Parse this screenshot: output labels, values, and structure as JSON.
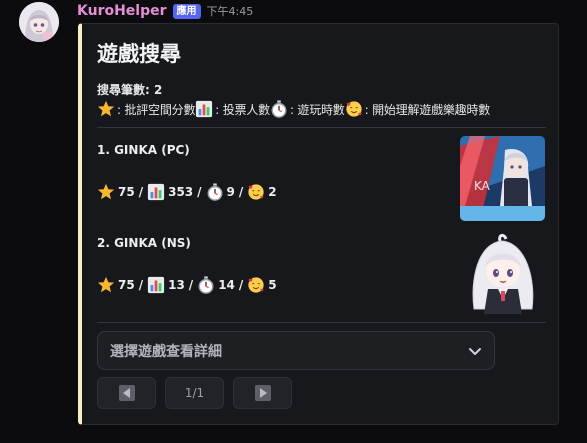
{
  "message": {
    "username": "KuroHelper",
    "badge": "應用",
    "timestamp": "下午4:45"
  },
  "embed": {
    "title": "遊戲搜尋",
    "count_label": "搜尋筆數: 2",
    "accent_color": "#f5f1c0",
    "legend": [
      {
        "icon": "star-icon",
        "text": ": 批評空間分數 "
      },
      {
        "icon": "bar-chart-icon",
        "text": ": 投票人數 "
      },
      {
        "icon": "stopwatch-icon",
        "text": ": 遊玩時數"
      },
      {
        "icon": "smiling-hearts-icon",
        "text": ": 開始理解遊戲樂趣時數"
      }
    ],
    "games": [
      {
        "name": "1. GINKA (PC)",
        "score": "75",
        "votes": "353",
        "hours": "9",
        "fun_hours": "2",
        "separator": "/"
      },
      {
        "name": "2. GINKA (NS)",
        "score": "75",
        "votes": "13",
        "hours": "14",
        "fun_hours": "5",
        "separator": "/"
      }
    ],
    "select_placeholder": "選擇遊戲查看詳細",
    "pagination": {
      "page": "1/1"
    }
  }
}
